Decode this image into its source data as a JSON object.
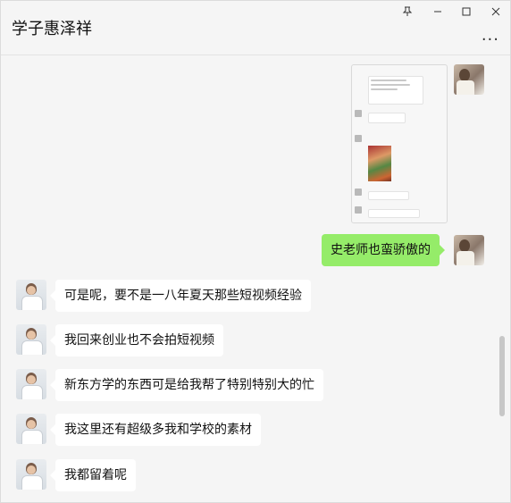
{
  "window": {
    "title": "学子惠泽祥",
    "controls": {
      "pin_icon": "pin-icon",
      "minimize_icon": "minimize-icon",
      "maximize_icon": "maximize-icon",
      "close_icon": "close-icon"
    },
    "more_label": "..."
  },
  "messages": [
    {
      "sender": "me",
      "type": "image"
    },
    {
      "sender": "me",
      "type": "text",
      "text": "史老师也蛮骄傲的"
    },
    {
      "sender": "other",
      "type": "text",
      "text": "可是呢，要不是一八年夏天那些短视频经验"
    },
    {
      "sender": "other",
      "type": "text",
      "text": "我回来创业也不会拍短视频"
    },
    {
      "sender": "other",
      "type": "text",
      "text": "新东方学的东西可是给我帮了特别特别大的忙"
    },
    {
      "sender": "other",
      "type": "text",
      "text": "我这里还有超级多我和学校的素材"
    },
    {
      "sender": "other",
      "type": "text",
      "text": "我都留着呢"
    }
  ],
  "colors": {
    "background": "#f5f5f5",
    "my_bubble": "#95ec69",
    "other_bubble": "#ffffff"
  }
}
